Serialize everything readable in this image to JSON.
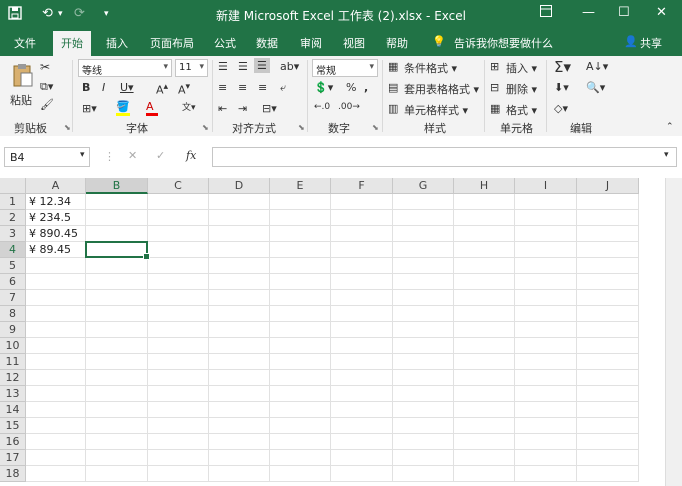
{
  "titlebar": {
    "title": "新建 Microsoft Excel 工作表 (2).xlsx  -  Excel",
    "save_icon": "save-icon",
    "undo_icon": "undo-icon",
    "redo_icon": "redo-icon"
  },
  "tabs": {
    "file": "文件",
    "home": "开始",
    "insert": "插入",
    "layout": "页面布局",
    "formulas": "公式",
    "data": "数据",
    "review": "审阅",
    "view": "视图",
    "help": "帮助",
    "tell": "告诉我你想要做什么",
    "share": "共享"
  },
  "ribbon": {
    "paste": "粘贴",
    "clipboard": "剪贴板",
    "font_name": "等线",
    "font_size": "11",
    "font_group": "字体",
    "align_group": "对齐方式",
    "number_format": "常规",
    "number_group": "数字",
    "cond_format": "条件格式",
    "table_format": "套用表格格式",
    "cell_style": "单元格样式",
    "styles_group": "样式",
    "insert": "插入",
    "delete": "删除",
    "format": "格式",
    "cells_group": "单元格",
    "editing_group": "编辑"
  },
  "formula_bar": {
    "name_box": "B4",
    "formula": "",
    "fx": "fx"
  },
  "sheet": {
    "columns": [
      "A",
      "B",
      "C",
      "D",
      "E",
      "F",
      "G",
      "H",
      "I",
      "J"
    ],
    "rows": [
      "1",
      "2",
      "3",
      "4",
      "5",
      "6",
      "7",
      "8",
      "9",
      "10",
      "11",
      "12",
      "13",
      "14",
      "15",
      "16",
      "17",
      "18"
    ],
    "values": [
      "¥ 12.34",
      "¥ 234.5",
      "¥ 890.45",
      "¥ 89.45"
    ],
    "selected_cell": "B4"
  },
  "colors": {
    "accent": "#217346"
  }
}
